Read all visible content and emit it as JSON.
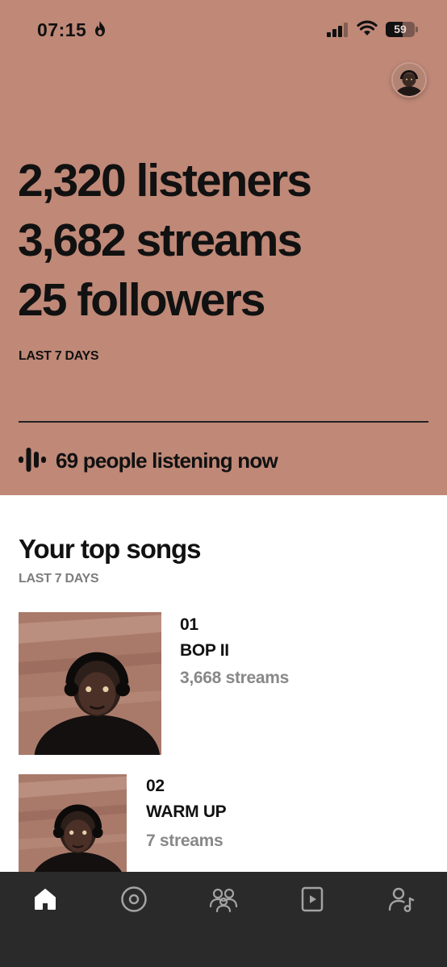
{
  "status_bar": {
    "time": "07:15",
    "battery_level": "59"
  },
  "stats": {
    "listeners": "2,320 listeners",
    "streams": "3,682 streams",
    "followers": "25 followers",
    "period": "LAST 7 DAYS"
  },
  "live": {
    "text": "69 people listening now"
  },
  "top_songs": {
    "title": "Your top songs",
    "period": "LAST 7 DAYS",
    "items": [
      {
        "rank": "01",
        "title": "BOP II",
        "streams": "3,668 streams"
      },
      {
        "rank": "02",
        "title": "WARM UP",
        "streams": "7 streams"
      }
    ]
  },
  "tabbar": {
    "items": [
      {
        "icon": "home-icon",
        "active": true
      },
      {
        "icon": "music-disc-icon",
        "active": false
      },
      {
        "icon": "audience-icon",
        "active": false
      },
      {
        "icon": "video-icon",
        "active": false
      },
      {
        "icon": "profile-icon",
        "active": false
      }
    ]
  },
  "colors": {
    "hero_background": "#bf8877",
    "tabbar_background": "#2a2a2a",
    "text_primary": "#111111",
    "text_muted": "#888888"
  }
}
